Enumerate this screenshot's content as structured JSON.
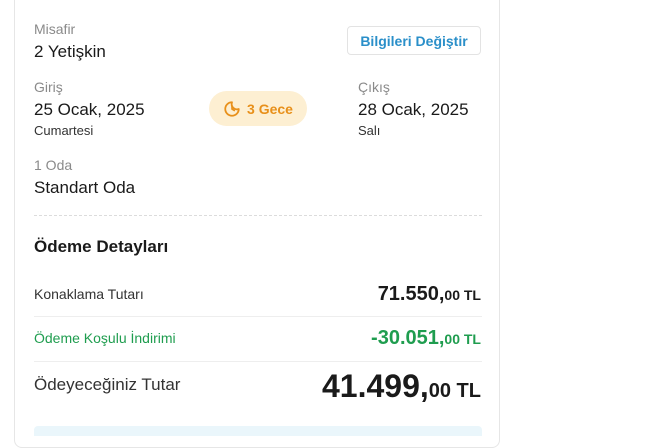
{
  "booking": {
    "guest_label": "Misafir",
    "guest_value": "2 Yetişkin",
    "edit_button": "Bilgileri Değiştir",
    "checkin_label": "Giriş",
    "checkin_date": "25 Ocak, 2025",
    "checkin_day": "Cumartesi",
    "nights_label": "3 Gece",
    "checkout_label": "Çıkış",
    "checkout_date": "28 Ocak, 2025",
    "checkout_day": "Salı",
    "room_label": "1 Oda",
    "room_value": "Standart Oda"
  },
  "payment": {
    "title": "Ödeme Detayları",
    "rows": [
      {
        "label": "Konaklama Tutarı",
        "amount_main": "71.550,",
        "amount_decimal": "00 TL"
      },
      {
        "label": "Ödeme Koşulu İndirimi",
        "amount_main": "-30.051,",
        "amount_decimal": "00 TL"
      },
      {
        "label": "Ödeyeceğiniz Tutar",
        "amount_main": "41.499,",
        "amount_decimal": "00 TL"
      }
    ]
  },
  "colors": {
    "accent_blue": "#2a8fc9",
    "discount_green": "#1f9d4f",
    "nights_orange": "#e8901a",
    "nights_bg": "#fdefd2"
  },
  "icons": {
    "nights": "moon-clock-icon"
  }
}
